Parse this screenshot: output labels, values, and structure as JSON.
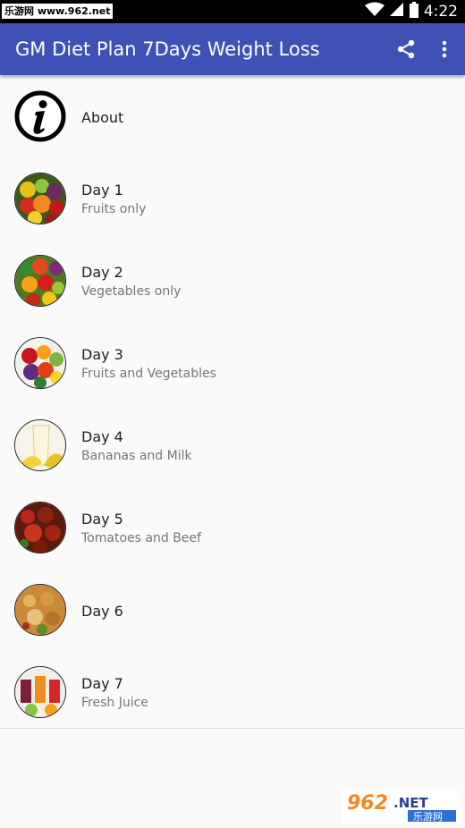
{
  "status_bar": {
    "watermark": "乐游网 www.962.net",
    "time": "4:22",
    "icons": [
      "wifi-icon",
      "signal-icon",
      "battery-icon"
    ]
  },
  "app_bar": {
    "title": "GM Diet Plan 7Days Weight Loss",
    "background": "#3f51b5",
    "actions": [
      "share-icon",
      "overflow-menu-icon"
    ]
  },
  "list": {
    "about": {
      "title": "About",
      "icon": "info-icon"
    },
    "days": [
      {
        "title": "Day 1",
        "subtitle": "Fruits only",
        "thumb": "fruits-thumbnail"
      },
      {
        "title": "Day 2",
        "subtitle": "Vegetables only",
        "thumb": "vegetables-thumbnail"
      },
      {
        "title": "Day 3",
        "subtitle": "Fruits and Vegetables",
        "thumb": "fruits-vegetables-thumbnail"
      },
      {
        "title": "Day 4",
        "subtitle": "Bananas and Milk",
        "thumb": "banana-milk-thumbnail"
      },
      {
        "title": "Day 5",
        "subtitle": "Tomatoes and Beef",
        "thumb": "tomato-beef-thumbnail"
      },
      {
        "title": "Day 6",
        "subtitle": "",
        "thumb": "rice-dish-thumbnail"
      },
      {
        "title": "Day 7",
        "subtitle": "Fresh Juice",
        "thumb": "juice-thumbnail"
      }
    ]
  },
  "watermark_bottom": {
    "text": "962.NET",
    "subtext": "乐游网"
  }
}
